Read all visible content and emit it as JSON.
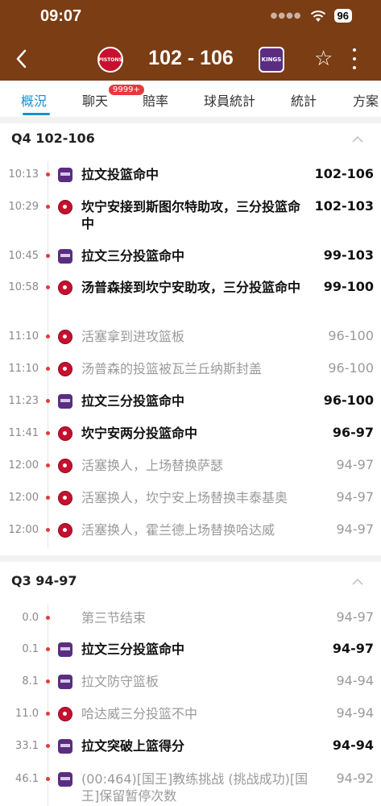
{
  "status": {
    "time": "09:07",
    "battery": "96"
  },
  "match": {
    "score": "102 - 106",
    "home_logo_text": "PISTONS",
    "away_logo_text": "KINGS"
  },
  "tabs": [
    "概況",
    "聊天",
    "賠率",
    "球員統計",
    "統計",
    "方案"
  ],
  "chat_badge": "9999+",
  "colors": {
    "header": "#7a3d14",
    "accent": "#1890d0",
    "badge": "#e8383d"
  },
  "quarters": [
    {
      "label": "Q4  102-106",
      "events": [
        {
          "time": "10:13",
          "team": "away",
          "text": "拉文投篮命中",
          "score": "102-106",
          "style": "bold"
        },
        {
          "time": "10:29",
          "team": "home",
          "text": "坎宁安接到斯图尔特助攻，三分投篮命中",
          "score": "102-103",
          "style": "bold"
        },
        {
          "time": "10:45",
          "team": "away",
          "text": "拉文三分投篮命中",
          "score": "99-103",
          "style": "bold"
        },
        {
          "time": "10:58",
          "team": "home",
          "text": "汤普森接到坎宁安助攻，三分投篮命中",
          "score": "99-100",
          "style": "bold"
        },
        {
          "time": "11:10",
          "team": "home",
          "text": "活塞拿到进攻篮板",
          "score": "96-100",
          "style": "dim"
        },
        {
          "time": "11:10",
          "team": "home",
          "text": "汤普森的投篮被瓦兰丘纳斯封盖",
          "score": "96-100",
          "style": "dim"
        },
        {
          "time": "11:23",
          "team": "away",
          "text": "拉文三分投篮命中",
          "score": "96-100",
          "style": "bold"
        },
        {
          "time": "11:41",
          "team": "home",
          "text": "坎宁安两分投篮命中",
          "score": "96-97",
          "style": "bold"
        },
        {
          "time": "12:00",
          "team": "home",
          "text": "活塞换人，上场替换萨瑟",
          "score": "94-97",
          "style": "dim"
        },
        {
          "time": "12:00",
          "team": "home",
          "text": "活塞换人，坎宁安上场替换丰泰基奥",
          "score": "94-97",
          "style": "dim"
        },
        {
          "time": "12:00",
          "team": "home",
          "text": "活塞换人，霍兰德上场替换哈达威",
          "score": "94-97",
          "style": "dim"
        }
      ]
    },
    {
      "label": "Q3  94-97",
      "events": [
        {
          "time": "0.0",
          "team": "none",
          "text": "第三节结束",
          "score": "94-97",
          "style": "dim"
        },
        {
          "time": "0.1",
          "team": "away",
          "text": "拉文三分投篮命中",
          "score": "94-97",
          "style": "bold"
        },
        {
          "time": "8.1",
          "team": "away",
          "text": "拉文防守篮板",
          "score": "94-94",
          "style": "dim"
        },
        {
          "time": "11.0",
          "team": "home",
          "text": "哈达威三分投篮不中",
          "score": "94-94",
          "style": "dim"
        },
        {
          "time": "33.1",
          "team": "away",
          "text": "拉文突破上篮得分",
          "score": "94-94",
          "style": "bold"
        },
        {
          "time": "46.1",
          "team": "away",
          "text": "(00:464)[国王]教练挑战 (挑战成功)[国王]保留暂停次数",
          "score": "94-92",
          "style": "dim"
        }
      ]
    }
  ]
}
